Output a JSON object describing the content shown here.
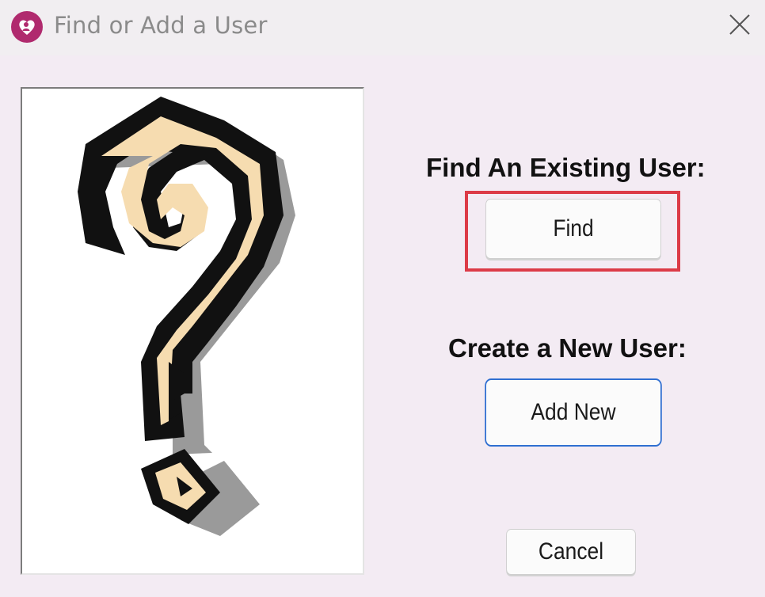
{
  "window": {
    "title": "Find or Add a User",
    "app_icon": "heart-person-icon",
    "close_icon": "close-icon",
    "accent_color": "#b02a6e"
  },
  "illustration": {
    "icon": "question-mark-illustration"
  },
  "find_section": {
    "heading": "Find An Existing User:",
    "button_label": "Find",
    "highlight_color": "#dc3b47"
  },
  "create_section": {
    "heading": "Create a New User:",
    "button_label": "Add New",
    "focus_color": "#2f6fd1"
  },
  "footer": {
    "cancel_label": "Cancel"
  }
}
